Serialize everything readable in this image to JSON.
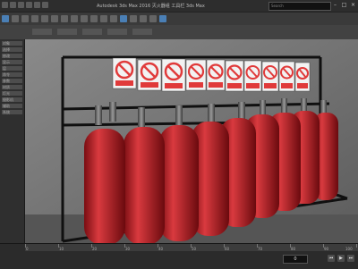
{
  "window": {
    "title": "Autodesk 3ds Max 2016   灭火器组   工具栏   3ds Max"
  },
  "search": {
    "placeholder": "Search"
  },
  "left_panel": {
    "items": [
      "对象",
      "选择",
      "修改",
      "显示",
      "层",
      "命令",
      "参数",
      "材质",
      "灯光",
      "摄影机",
      "辅助",
      "系统"
    ]
  },
  "viewport": {
    "signs": [
      {
        "icon": "no-fire-icon"
      },
      {
        "icon": "no-smoking-icon"
      },
      {
        "icon": "no-fire-icon"
      },
      {
        "icon": "warning-icon"
      },
      {
        "icon": "no-touch-icon"
      },
      {
        "icon": "no-fire-icon"
      },
      {
        "icon": "no-fire-icon"
      },
      {
        "icon": "no-fire-icon"
      },
      {
        "icon": "no-fire-icon"
      },
      {
        "icon": "no-fire-icon"
      }
    ],
    "cylinder_color": "#c8242a",
    "rack_color": "#101010",
    "sign_color": "#e03a3a"
  },
  "timeline": {
    "labels": [
      "0",
      "10",
      "20",
      "30",
      "40",
      "50",
      "60",
      "70",
      "80",
      "90",
      "100"
    ]
  },
  "status": {
    "text": ""
  },
  "frame": {
    "value": "0"
  }
}
